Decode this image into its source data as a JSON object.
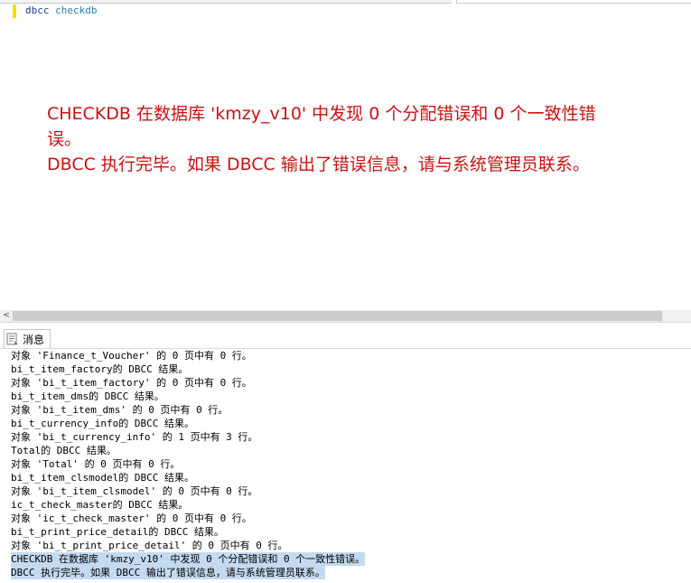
{
  "editor": {
    "code_keyword_1": "dbcc",
    "code_keyword_2": "checkdb",
    "annotation": [
      "CHECKDB 在数据库 'kmzy_v10' 中发现 0 个分配错误和 0 个一致性错误。",
      "DBCC 执行完毕。如果 DBCC 输出了错误信息，请与系统管理员联系。"
    ]
  },
  "scrollbar": {
    "left_arrow": "<"
  },
  "results": {
    "tab_label": "消息",
    "lines": [
      {
        "text": "对象 'Finance_t_Voucher' 的 0 页中有 0 行。",
        "highlight": false
      },
      {
        "text": "bi_t_item_factory的 DBCC 结果。",
        "highlight": false
      },
      {
        "text": "对象 'bi_t_item_factory' 的 0 页中有 0 行。",
        "highlight": false
      },
      {
        "text": "bi_t_item_dms的 DBCC 结果。",
        "highlight": false
      },
      {
        "text": "对象 'bi_t_item_dms' 的 0 页中有 0 行。",
        "highlight": false
      },
      {
        "text": "bi_t_currency_info的 DBCC 结果。",
        "highlight": false
      },
      {
        "text": "对象 'bi_t_currency_info' 的 1 页中有 3 行。",
        "highlight": false
      },
      {
        "text": "Total的 DBCC 结果。",
        "highlight": false
      },
      {
        "text": "对象 'Total' 的 0 页中有 0 行。",
        "highlight": false
      },
      {
        "text": "bi_t_item_clsmodel的 DBCC 结果。",
        "highlight": false
      },
      {
        "text": "对象 'bi_t_item_clsmodel' 的 0 页中有 0 行。",
        "highlight": false
      },
      {
        "text": "ic_t_check_master的 DBCC 结果。",
        "highlight": false
      },
      {
        "text": "对象 'ic_t_check_master' 的 0 页中有 0 行。",
        "highlight": false
      },
      {
        "text": "bi_t_print_price_detail的 DBCC 结果。",
        "highlight": false
      },
      {
        "text": "对象 'bi_t_print_price_detail' 的 0 页中有 0 行。",
        "highlight": false
      },
      {
        "text": "CHECKDB 在数据库 'kmzy_v10' 中发现 0 个分配错误和 0 个一致性错误。",
        "highlight": true
      },
      {
        "text": "DBCC 执行完毕。如果 DBCC 输出了错误信息，请与系统管理员联系。",
        "highlight": true
      }
    ]
  },
  "colors": {
    "annotation": "#d01010",
    "selection": "#c4daf0",
    "keyword_dbcc": "#1a3a9a",
    "keyword_checkdb": "#2a7fa8",
    "change_bar": "#f5e000"
  },
  "icons": {
    "tab_icon": "messages-icon",
    "scroll_left": "chevron-left-icon"
  }
}
